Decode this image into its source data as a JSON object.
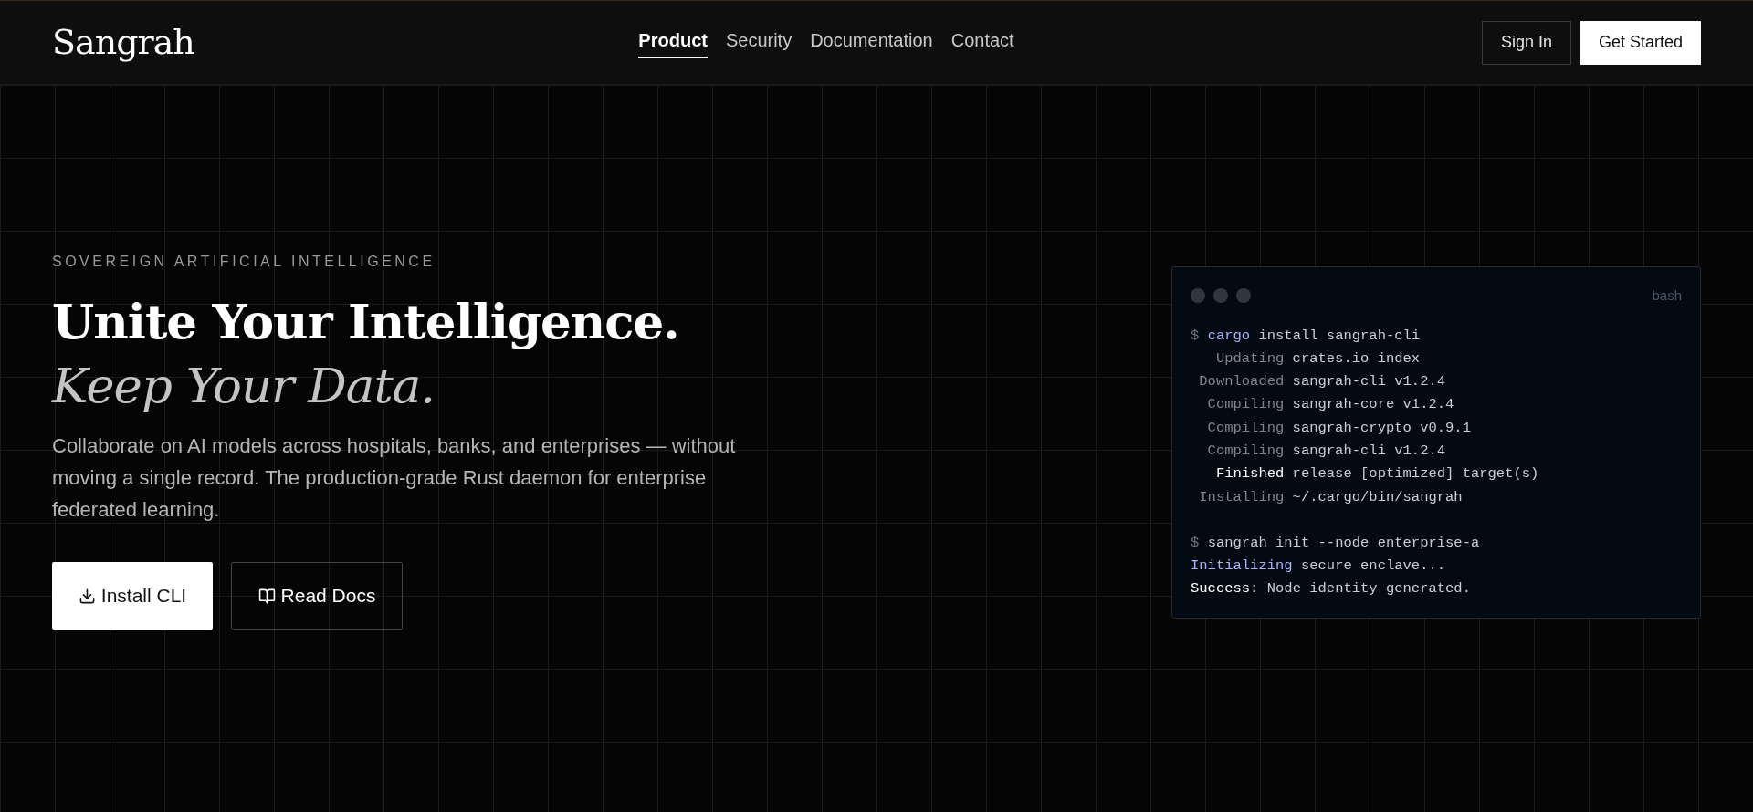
{
  "header": {
    "logo": "Sangrah",
    "nav": [
      {
        "label": "Product",
        "selected": true
      },
      {
        "label": "Security",
        "selected": false
      },
      {
        "label": "Documentation",
        "selected": false
      },
      {
        "label": "Contact",
        "selected": false
      }
    ],
    "sign_in": "Sign In",
    "get_started": "Get Started"
  },
  "hero": {
    "eyebrow": "SOVEREIGN ARTIFICIAL INTELLIGENCE",
    "title": "Unite Your Intelligence.",
    "subtitle": "Keep Your Data.",
    "description": "Collaborate on AI models across hospitals, banks, and enterprises — without moving a single record. The production-grade Rust daemon for enterprise federated learning.",
    "buttons": [
      {
        "label": "Install CLI",
        "kind": "primary"
      },
      {
        "label": "Read Docs",
        "kind": "secondary"
      }
    ]
  },
  "terminal": {
    "title": "bash",
    "lines": [
      {
        "kind": "command",
        "prompt": "$",
        "program": "cargo",
        "text": "install sangrah-cli"
      },
      {
        "kind": "status",
        "label": "Updating",
        "text": "crates.io index",
        "strong": false
      },
      {
        "kind": "status",
        "label": "Downloaded",
        "text": "sangrah-cli v1.2.4",
        "strong": false
      },
      {
        "kind": "status",
        "label": "Compiling",
        "text": "sangrah-core v1.2.4",
        "strong": false
      },
      {
        "kind": "status",
        "label": "Compiling",
        "text": "sangrah-crypto v0.9.1",
        "strong": false
      },
      {
        "kind": "status",
        "label": "Compiling",
        "text": "sangrah-cli v1.2.4",
        "strong": false
      },
      {
        "kind": "status",
        "label": "Finished",
        "text": "release [optimized] target(s)",
        "strong": true
      },
      {
        "kind": "status",
        "label": "Installing",
        "text": "~/.cargo/bin/sangrah",
        "strong": false
      },
      {
        "kind": "spacer"
      },
      {
        "kind": "command",
        "prompt": "$",
        "text": "sangrah init --node enterprise-a"
      },
      {
        "kind": "info",
        "label": "Initializing",
        "text": "secure enclave..."
      },
      {
        "kind": "success",
        "label": "Success:",
        "text": "Node identity generated."
      }
    ]
  }
}
